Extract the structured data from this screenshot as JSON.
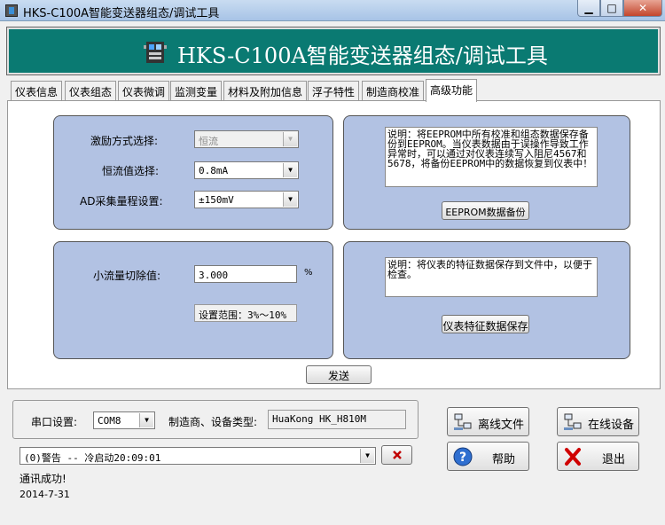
{
  "window": {
    "title": "HKS-C100A智能变送器组态/调试工具",
    "min_label": "▁",
    "max_label": "□",
    "close_label": "✕"
  },
  "banner": {
    "heading": "HKS-C100A智能变送器组态/调试工具"
  },
  "tabs": [
    {
      "label": "仪表信息"
    },
    {
      "label": "仪表组态"
    },
    {
      "label": "仪表微调"
    },
    {
      "label": "监测变量"
    },
    {
      "label": "材料及附加信息"
    },
    {
      "label": "浮子特性"
    },
    {
      "label": "制造商校准"
    },
    {
      "label": "高级功能",
      "active": true
    }
  ],
  "excitation": {
    "mode_label": "激励方式选择:",
    "mode_value": "恒流",
    "current_label": "恒流值选择:",
    "current_value": "0.8mA",
    "range_label": "AD采集量程设置:",
    "range_value": "±150mV"
  },
  "backup": {
    "description": "说明：将EEPROM中所有校准和组态数据保存备份到EEPROM。当仪表数据由于误操作导致工作异常时，可以通过对仪表连续写入阻尼4567和5678，将备份EEPROM中的数据恢复到仪表中！",
    "button_label": "EEPROM数据备份"
  },
  "cutoff": {
    "label": "小流量切除值:",
    "value": "3.000",
    "unit": "%",
    "range_text": "设置范围：3%～10%"
  },
  "save_features": {
    "description": "说明：将仪表的特征数据保存到文件中，以便于检查。",
    "button_label": "仪表特征数据保存"
  },
  "send_button": "发送",
  "comm": {
    "port_label": "串口设置:",
    "port_value": "COM8",
    "device_label": "制造商、设备类型:",
    "device_value": "HuaKong HK_H810M"
  },
  "log": {
    "value": "(0)警告 -- 冷启动20:09:01",
    "clear_icon": "red-x-icon",
    "status": "通讯成功!",
    "date": "2014-7-31"
  },
  "actions": {
    "offline_file": "离线文件",
    "online_device": "在线设备",
    "help": "帮助",
    "exit": "退出"
  },
  "colors": {
    "banner": "#0a7a72",
    "group": "#b2c2e3"
  }
}
